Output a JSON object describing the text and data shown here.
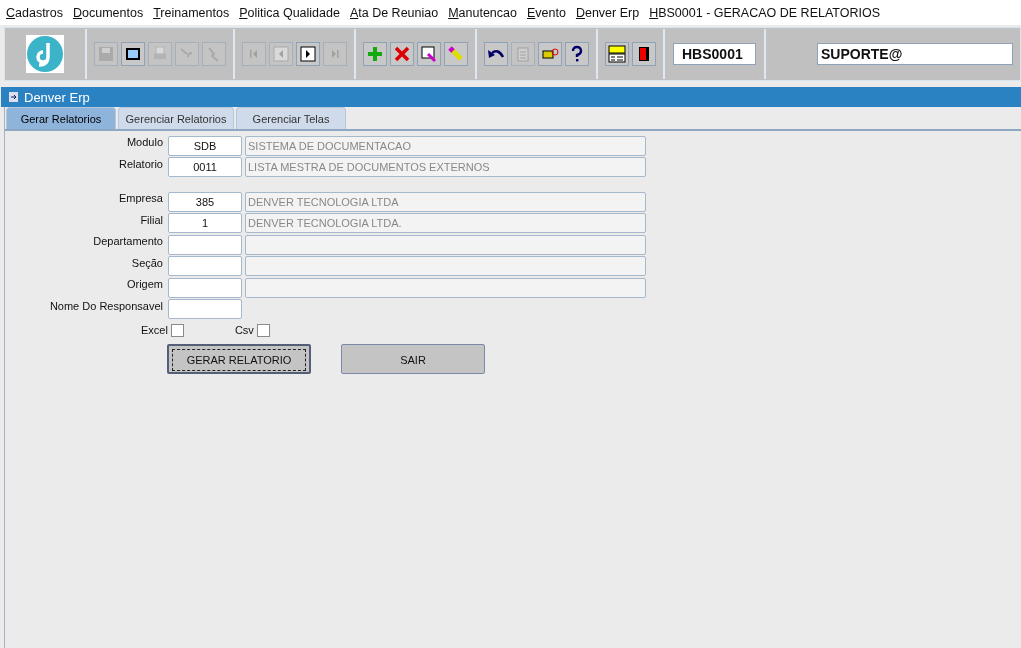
{
  "menu": [
    "Cadastros",
    "Documentos",
    "Treinamentos",
    "Politica Qualidade",
    "Ata De Reuniao",
    "Manutencao",
    "Evento",
    "Denver Erp",
    "HBS0001 - GERACAO DE RELATORIOS"
  ],
  "toolbar": {
    "groups": [
      [
        {
          "kind": "save",
          "disabled": true
        },
        {
          "kind": "window",
          "disabled": false
        },
        {
          "kind": "print",
          "disabled": true
        },
        {
          "kind": "query",
          "disabled": true
        },
        {
          "kind": "execute",
          "disabled": true
        }
      ],
      [
        {
          "kind": "first",
          "disabled": true
        },
        {
          "kind": "prev",
          "disabled": true
        },
        {
          "kind": "next",
          "disabled": false
        },
        {
          "kind": "last",
          "disabled": true
        }
      ],
      [
        {
          "kind": "add",
          "disabled": false
        },
        {
          "kind": "delete",
          "disabled": false
        },
        {
          "kind": "edit",
          "disabled": false
        },
        {
          "kind": "clear",
          "disabled": false
        }
      ],
      [
        {
          "kind": "undo",
          "disabled": false
        },
        {
          "kind": "paste",
          "disabled": true
        },
        {
          "kind": "point",
          "disabled": false
        },
        {
          "kind": "help",
          "disabled": false
        }
      ],
      [
        {
          "kind": "menu",
          "disabled": false
        },
        {
          "kind": "exit",
          "disabled": false
        }
      ]
    ],
    "form_code": "HBS0001",
    "user": "SUPORTE@"
  },
  "window": {
    "title": "Denver Erp"
  },
  "tabs": [
    {
      "label": "Gerar Relatorios",
      "selected": true
    },
    {
      "label": "Gerenciar Relatorios",
      "selected": false
    },
    {
      "label": "Gerenciar Telas",
      "selected": false
    }
  ],
  "field_groups": [
    [
      {
        "kind": "lookup",
        "label": "Modulo",
        "code": "SDB",
        "description": "SISTEMA DE DOCUMENTACAO"
      },
      {
        "kind": "lookup",
        "label": "Relatorio",
        "code": "0011",
        "description": "LISTA MESTRA DE DOCUMENTOS EXTERNOS"
      }
    ],
    [
      {
        "kind": "lookup",
        "label": "Empresa",
        "code": "385",
        "description": "DENVER TECNOLOGIA LTDA"
      },
      {
        "kind": "lookup",
        "label": "Filial",
        "code": "1",
        "description": "DENVER TECNOLOGIA LTDA."
      },
      {
        "kind": "lookup",
        "label": "Departamento"
      },
      {
        "kind": "lookup",
        "label": "Seção"
      },
      {
        "kind": "lookup",
        "label": "Origem"
      },
      {
        "kind": "single",
        "label": "Nome Do Responsavel"
      }
    ]
  ],
  "checkboxes": [
    {
      "label": "Excel",
      "checked": false
    },
    {
      "label": "Csv",
      "checked": false
    }
  ],
  "buttons": [
    {
      "label": "GERAR RELATORIO",
      "focused": true
    },
    {
      "label": "SAIR",
      "focused": false
    }
  ]
}
